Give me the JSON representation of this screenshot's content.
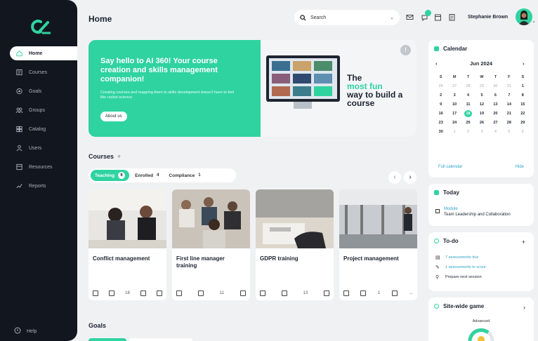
{
  "sidebar": {
    "items": [
      {
        "label": "Home",
        "icon": "home-icon",
        "active": true
      },
      {
        "label": "Courses",
        "icon": "courses-icon"
      },
      {
        "label": "Goals",
        "icon": "goals-icon"
      },
      {
        "label": "Groups",
        "icon": "groups-icon"
      },
      {
        "label": "Catalog",
        "icon": "catalog-icon"
      },
      {
        "label": "Users",
        "icon": "users-icon"
      },
      {
        "label": "Resources",
        "icon": "resources-icon"
      },
      {
        "label": "Reports",
        "icon": "reports-icon"
      }
    ],
    "help_label": "Help"
  },
  "header": {
    "title": "Home",
    "search_placeholder": "Search",
    "user_name": "Stephanie Brown"
  },
  "hero": {
    "title": "Say hello to AI 360! Your course creation and skills management companion!",
    "subtitle": "Creating courses and mapping them to skills development doesn't have to feel like rocket science.",
    "button_label": "About us",
    "tagline_1": "The",
    "tagline_2": "most fun",
    "tagline_3": "way to build a course",
    "close_label": "!"
  },
  "courses": {
    "title": "Courses",
    "add_label": "+",
    "tabs": [
      {
        "label": "Teaching",
        "count": "6",
        "active": true
      },
      {
        "label": "Enrolled",
        "count": "4"
      },
      {
        "label": "Compliance",
        "count": "1"
      }
    ],
    "cards": [
      {
        "title": "Conflict management",
        "stats": [
          "",
          "",
          "18",
          "",
          ""
        ]
      },
      {
        "title": "First line manager training",
        "stats": [
          "",
          "",
          "11",
          ""
        ]
      },
      {
        "title": "GDPR training",
        "stats": [
          "",
          "",
          "13",
          ""
        ]
      },
      {
        "title": "Project management",
        "stats": [
          "",
          "",
          "1",
          "",
          "→"
        ]
      }
    ]
  },
  "goals": {
    "title": "Goals"
  },
  "calendar": {
    "title": "Calendar",
    "month": "Jun 2024",
    "weekdays": [
      "S",
      "M",
      "T",
      "W",
      "T",
      "F",
      "S"
    ],
    "days": [
      "26",
      "27",
      "28",
      "29",
      "30",
      "31",
      "1",
      "2",
      "3",
      "4",
      "5",
      "6",
      "7",
      "8",
      "9",
      "10",
      "11",
      "12",
      "13",
      "14",
      "15",
      "16",
      "17",
      "18",
      "19",
      "20",
      "21",
      "22",
      "23",
      "24",
      "25",
      "26",
      "27",
      "28",
      "29",
      "30",
      "1",
      "2",
      "3",
      "4",
      "5",
      "6"
    ],
    "today_index": 23,
    "full_calendar_label": "Full calendar",
    "hide_label": "Hide"
  },
  "today": {
    "title": "Today",
    "module_label": "Module",
    "module_name": "Team Leadership and Collaboration"
  },
  "todo": {
    "title": "To-do",
    "add_label": "+",
    "items": [
      {
        "label": "7 assessments due",
        "link": true
      },
      {
        "label": "1 assessments to score",
        "link": true
      },
      {
        "label": "Prepare next session",
        "link": false
      }
    ]
  },
  "game": {
    "title": "Site-wide game",
    "level_label": "Advanced"
  },
  "colors": {
    "accent": "#2fd3a0",
    "sidebar": "#12161f",
    "link": "#2fa4c8"
  }
}
